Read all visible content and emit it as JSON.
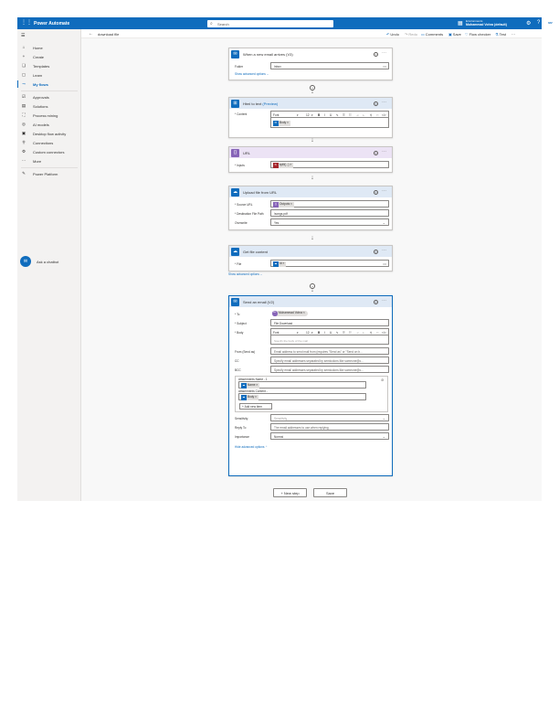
{
  "app": {
    "name": "Power Automate",
    "search_placeholder": "Search",
    "environment_label": "Environments",
    "environment_name": "Muhammad Vohra (default)",
    "avatar_initials": "MV"
  },
  "sidebar": {
    "items": [
      {
        "label": "Home",
        "icon": "⌂"
      },
      {
        "label": "Create",
        "icon": "+"
      },
      {
        "label": "Templates",
        "icon": "❏"
      },
      {
        "label": "Learn",
        "icon": "▢"
      },
      {
        "label": "My flows",
        "icon": "⤳"
      },
      {
        "label": "Approvals",
        "icon": "☑"
      },
      {
        "label": "Solutions",
        "icon": "▤"
      },
      {
        "label": "Process mining",
        "icon": "⛶"
      },
      {
        "label": "AI models",
        "icon": "◎"
      },
      {
        "label": "Desktop flow activity",
        "icon": "▣"
      },
      {
        "label": "Connections",
        "icon": "⚲"
      },
      {
        "label": "Custom connectors",
        "icon": "⚙"
      },
      {
        "label": "More",
        "icon": "⋯"
      },
      {
        "label": "Power Platform",
        "icon": "✎"
      }
    ],
    "chatbot_label": "Ask a chatbot"
  },
  "cmdbar": {
    "title": "download file",
    "undo": "Undo",
    "redo": "Redo",
    "comments": "Comments",
    "save": "Save",
    "flow_checker": "Flow checker",
    "test": "Test"
  },
  "cards": {
    "trigger": {
      "title": "When a new email arrives (V3)",
      "folder_label": "Folder",
      "folder_value": "Inbox",
      "advanced": "Show advanced options"
    },
    "html": {
      "title": "Html to text",
      "preview": "(Preview)",
      "content_label": "* Content",
      "font": "Font",
      "size": "12",
      "token": "Body"
    },
    "url": {
      "title": "URL",
      "inputs_label": "* Inputs",
      "token": "split(...)"
    },
    "upload": {
      "title": "Upload file from URL",
      "source_label": "* Source URL",
      "source_token": "Outputs",
      "dest_label": "* Destination File Path",
      "dest_value": "/songs.pdf",
      "overwrite_label": "Overwrite",
      "overwrite_value": "Yes"
    },
    "getfile": {
      "title": "Get file content",
      "file_label": "* File",
      "file_token": "Id",
      "advanced": "Show advanced options"
    },
    "email": {
      "title": "Send an email (V2)",
      "to_label": "* To",
      "to_value": "Muhammad Vohra",
      "to_initials": "MV",
      "subject_label": "* Subject",
      "subject_value": "File Download",
      "body_label": "* Body",
      "font": "Font",
      "size": "12",
      "body_placeholder": "Specify the body of the mail",
      "from_label": "From (Send as)",
      "from_placeholder": "Email address to send mail from (requires \"Send as\" or \"Send on b...",
      "cc_label": "CC",
      "cc_placeholder": "Specify email addresses separated by semicolons like someone@c...",
      "bcc_label": "BCC",
      "bcc_placeholder": "Specify email addresses separated by semicolons like someone@c...",
      "att_name_label": "Attachments Name - 1",
      "att_name_token": "Name",
      "att_content_label": "Attachments Content -",
      "att_content_token": "Body",
      "add_item": "Add new item",
      "sensitivity_label": "Sensitivity",
      "sensitivity_placeholder": "Sensitivity",
      "replyto_label": "Reply To",
      "replyto_placeholder": "The email addresses to use when replying",
      "importance_label": "Importance",
      "importance_value": "Normal",
      "hide_advanced": "Hide advanced options"
    }
  },
  "bottom": {
    "new_step": "+ New step",
    "save": "Save"
  },
  "colors": {
    "brand": "#0f6cbd",
    "outlook": "#0f6cbd",
    "html_card": "#0f6cbd",
    "url_card": "#8764b8",
    "onedrive": "#0f6cbd"
  }
}
